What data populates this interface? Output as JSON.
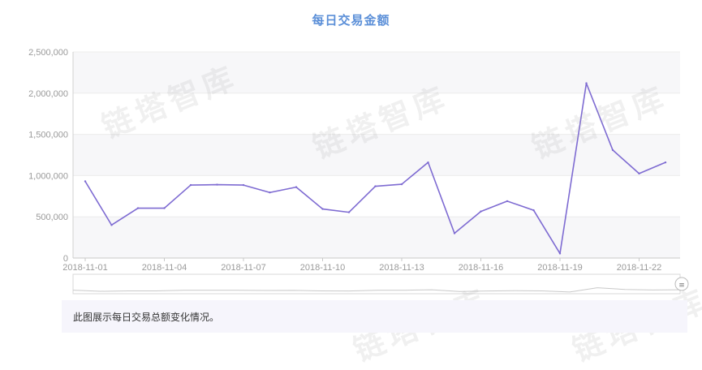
{
  "chart_data": {
    "type": "line",
    "title": "每日交易金额",
    "x": [
      "2018-11-01",
      "2018-11-02",
      "2018-11-03",
      "2018-11-04",
      "2018-11-05",
      "2018-11-06",
      "2018-11-07",
      "2018-11-08",
      "2018-11-09",
      "2018-11-10",
      "2018-11-11",
      "2018-11-12",
      "2018-11-13",
      "2018-11-14",
      "2018-11-15",
      "2018-11-16",
      "2018-11-17",
      "2018-11-18",
      "2018-11-19",
      "2018-11-20",
      "2018-11-21",
      "2018-11-22",
      "2018-11-23"
    ],
    "x_tick_labels": [
      "2018-11-01",
      "2018-11-04",
      "2018-11-07",
      "2018-11-10",
      "2018-11-13",
      "2018-11-16",
      "2018-11-19",
      "2018-11-22"
    ],
    "values": [
      930000,
      400000,
      605000,
      605000,
      885000,
      890000,
      885000,
      795000,
      860000,
      595000,
      555000,
      870000,
      895000,
      1160000,
      300000,
      565000,
      690000,
      580000,
      55000,
      2120000,
      1310000,
      1025000,
      1160000
    ],
    "y_ticks": [
      "0",
      "500,000",
      "1,000,000",
      "1,500,000",
      "2,000,000",
      "2,500,000"
    ],
    "ylim": [
      0,
      2500000
    ],
    "line_color": "#7e6bd2",
    "grid": true,
    "legend": "none",
    "data_zoom": true
  },
  "watermark_text": "链塔智库",
  "caption": "此图展示每日交易总额变化情况。"
}
